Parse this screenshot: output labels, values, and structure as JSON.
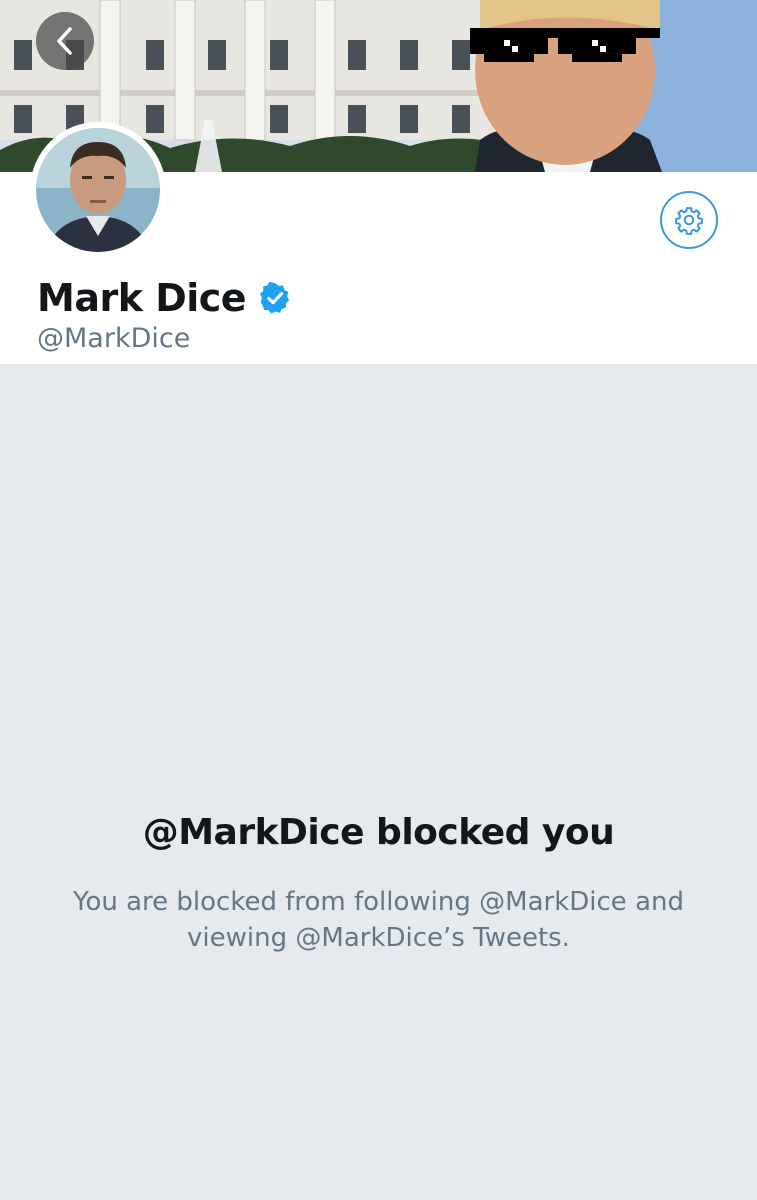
{
  "header": {
    "banner_image": "white-house-with-pixel-sunglasses",
    "back_icon": "chevron-left-icon"
  },
  "profile": {
    "avatar": "profile-photo",
    "display_name": "Mark Dice",
    "verified_icon": "verified-badge-icon",
    "handle": "@MarkDice",
    "settings_icon": "gear-icon"
  },
  "blocked": {
    "title": "@MarkDice blocked you",
    "message": "You are blocked from following @MarkDice and viewing @MarkDice’s Tweets."
  },
  "colors": {
    "accent": "#1da1f2",
    "text_primary": "#14171a",
    "text_secondary": "#657786",
    "background": "#e6e9ee"
  }
}
